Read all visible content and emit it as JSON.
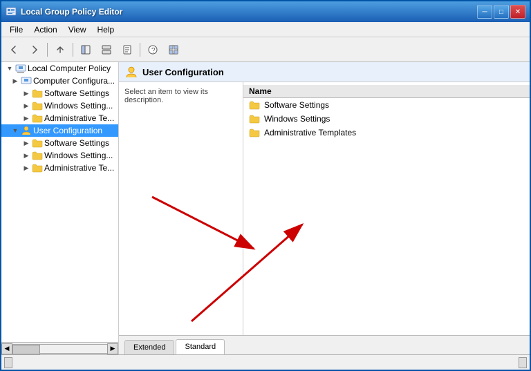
{
  "window": {
    "title": "Local Group Policy Editor",
    "buttons": {
      "minimize": "─",
      "maximize": "□",
      "close": "✕"
    }
  },
  "menu": {
    "items": [
      "File",
      "Action",
      "View",
      "Help"
    ]
  },
  "toolbar": {
    "buttons": [
      "◀",
      "▶",
      "↑",
      "⊡",
      "⊟",
      "⊞",
      "?",
      "⊠"
    ]
  },
  "sidebar": {
    "root_label": "Local Computer Policy",
    "items": [
      {
        "id": "computer-config",
        "label": "Computer Configura...",
        "level": 1,
        "expanded": true,
        "hasChildren": true
      },
      {
        "id": "software-settings-cc",
        "label": "Software Settings",
        "level": 2,
        "hasChildren": true
      },
      {
        "id": "windows-settings-cc",
        "label": "Windows Setting...",
        "level": 2,
        "hasChildren": true
      },
      {
        "id": "admin-templates-cc",
        "label": "Administrative Te...",
        "level": 2,
        "hasChildren": true
      },
      {
        "id": "user-config",
        "label": "User Configuration",
        "level": 1,
        "expanded": true,
        "selected": true,
        "hasChildren": true
      },
      {
        "id": "software-settings-uc",
        "label": "Software Settings",
        "level": 2,
        "hasChildren": true
      },
      {
        "id": "windows-settings-uc",
        "label": "Windows Setting...",
        "level": 2,
        "hasChildren": true
      },
      {
        "id": "admin-templates-uc",
        "label": "Administrative Te...",
        "level": 2,
        "hasChildren": true
      }
    ]
  },
  "panel": {
    "header_title": "User Configuration",
    "description": "Select an item to view its description.",
    "list_column": "Name",
    "list_items": [
      {
        "id": "software-settings",
        "label": "Software Settings"
      },
      {
        "id": "windows-settings",
        "label": "Windows Settings"
      },
      {
        "id": "admin-templates",
        "label": "Administrative Templates"
      }
    ]
  },
  "tabs": [
    {
      "id": "extended",
      "label": "Extended"
    },
    {
      "id": "standard",
      "label": "Standard",
      "active": true
    }
  ]
}
